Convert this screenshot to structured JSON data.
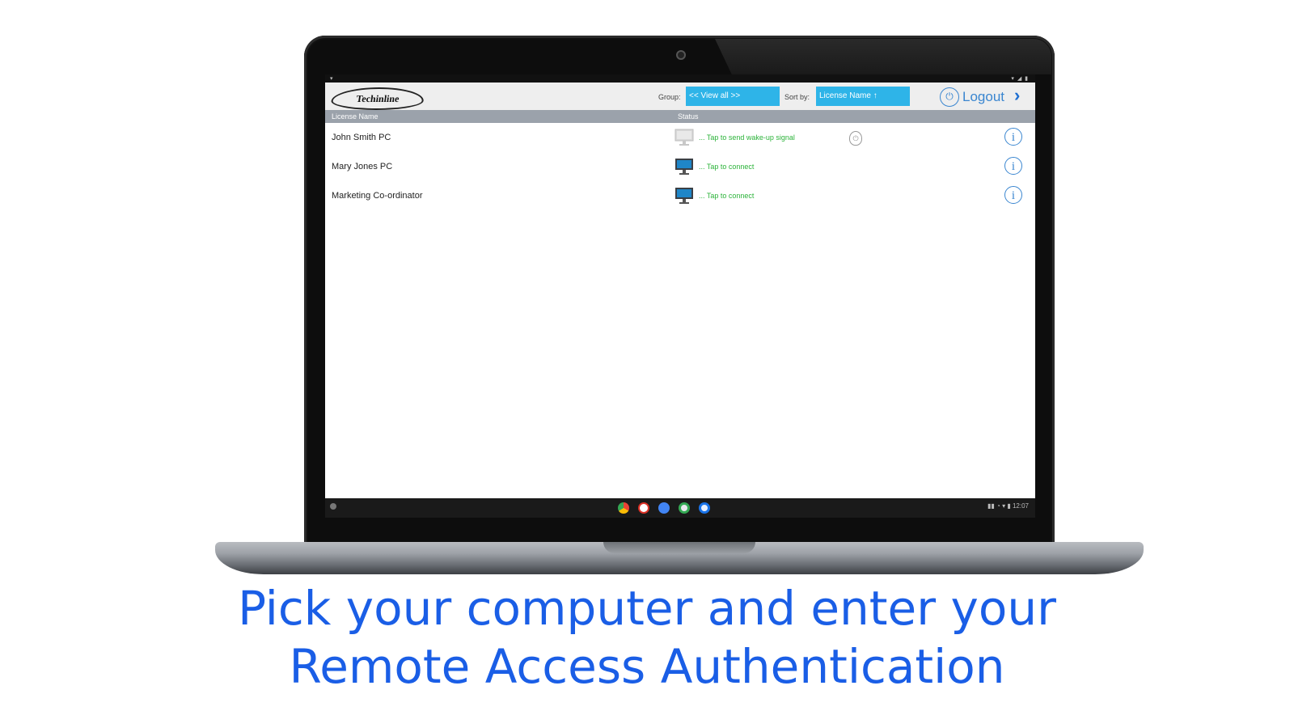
{
  "app": {
    "logo_text": "Techinline",
    "group_label": "Group:",
    "group_value": "<< View all >>",
    "sort_label": "Sort by:",
    "sort_value": "License Name ↑",
    "logout_label": "Logout",
    "logout_icon": "power-icon",
    "columns": [
      "License Name",
      "Status"
    ],
    "rows": [
      {
        "name": "John Smith PC",
        "status": "... Tap to send wake-up signal",
        "monitor_state": "off",
        "has_wake": true
      },
      {
        "name": "Mary Jones PC",
        "status": "... Tap to connect",
        "monitor_state": "on",
        "has_wake": false
      },
      {
        "name": "Marketing Co-ordinator",
        "status": "... Tap to connect",
        "monitor_state": "on",
        "has_wake": false
      }
    ],
    "info_glyph": "i",
    "status_color": "#2cb33a",
    "accent_color": "#2eb4e8",
    "link_color": "#3a86d0"
  },
  "taskbar": {
    "apps": [
      "chrome-icon",
      "gmail-icon",
      "docs-icon",
      "play-store-icon",
      "messages-icon"
    ],
    "tray_text": "▮▮ ◔ ▾ ▮ 12:07"
  },
  "caption": {
    "line1": "Pick your computer and enter your",
    "line2": "Remote Access Authentication"
  }
}
